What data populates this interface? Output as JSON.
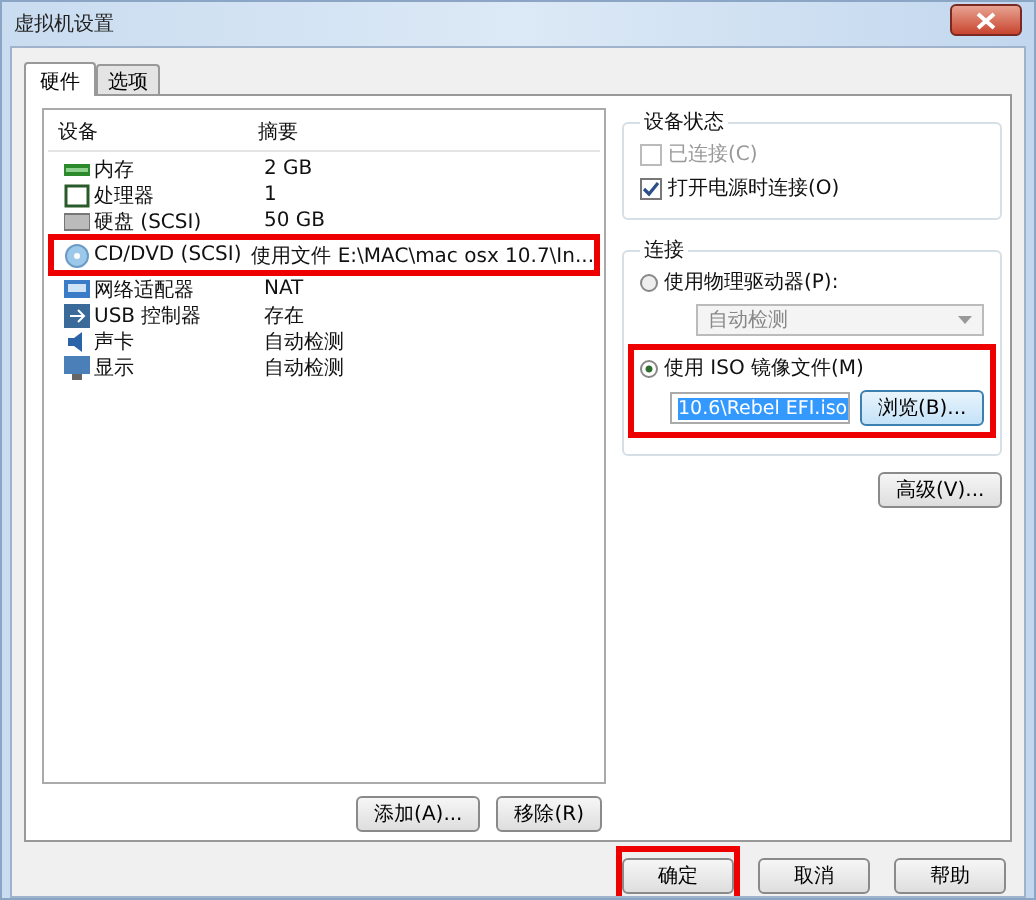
{
  "window": {
    "title": "虚拟机设置"
  },
  "tabs": [
    {
      "label": "硬件",
      "selected": true
    },
    {
      "label": "选项",
      "selected": false
    }
  ],
  "devices": {
    "columns": [
      "设备",
      "摘要"
    ],
    "rows": [
      {
        "kind": "memory",
        "device": "内存",
        "summary": "2 GB"
      },
      {
        "kind": "cpu",
        "device": "处理器",
        "summary": "1"
      },
      {
        "kind": "disk",
        "device": "硬盘 (SCSI)",
        "summary": "50 GB"
      },
      {
        "kind": "cd",
        "device": "CD/DVD (SCSI)",
        "summary": "使用文件 E:\\MAC\\mac osx 10.7\\In...",
        "highlighted": true
      },
      {
        "kind": "network",
        "device": "网络适配器",
        "summary": "NAT"
      },
      {
        "kind": "usb",
        "device": "USB 控制器",
        "summary": "存在"
      },
      {
        "kind": "sound",
        "device": "声卡",
        "summary": "自动检测"
      },
      {
        "kind": "display",
        "device": "显示",
        "summary": "自动检测"
      }
    ]
  },
  "device_buttons": [
    "添加(A)...",
    "移除(R)"
  ],
  "device_status": {
    "title": "设备状态",
    "checkboxes": [
      {
        "label": "已连接(C)",
        "checked": false,
        "disabled": true
      },
      {
        "label": "打开电源时连接(O)",
        "checked": true,
        "disabled": false
      }
    ]
  },
  "connection": {
    "title": "连接",
    "physical": {
      "label": "使用物理驱动器(P):",
      "selected": false,
      "dropdown": "自动检测"
    },
    "iso": {
      "label": "使用 ISO 镜像文件(M)",
      "selected": true,
      "file": "10.6\\Rebel EFI.iso",
      "browse": "浏览(B)...",
      "highlighted": true
    },
    "advanced": "高级(V)..."
  },
  "footer_buttons": [
    {
      "label": "确定",
      "highlighted": true
    },
    {
      "label": "取消",
      "highlighted": false
    },
    {
      "label": "帮助",
      "highlighted": false
    }
  ]
}
